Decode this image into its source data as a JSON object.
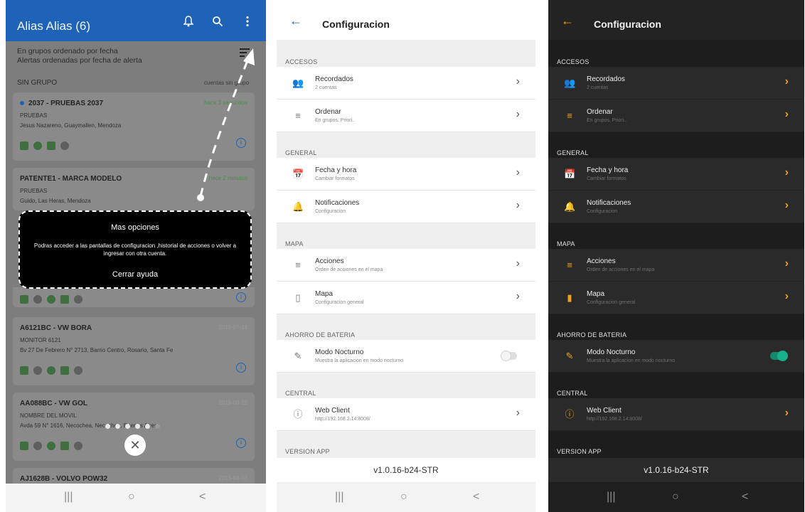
{
  "panel1": {
    "title": "Alias Alias (6)",
    "sub1": "En grupos ordenado por fecha",
    "sub2": "Alertas ordenadas por fecha de alerta",
    "group": "SIN GRUPO",
    "group_right": "cuentas sin grupo",
    "cards": [
      {
        "title": "2037 - PRUEBAS 2037",
        "time": "hace 3 segundos",
        "l2": "PRUEBAS",
        "l3": "Jesus Nazareno, Guaymallen, Mendoza"
      },
      {
        "title": "PATENTE1 - MARCA MODELO",
        "time": "hace 2 minutos",
        "l2": "PRUEBAS",
        "l3": "Guido, Las Heras, Mendoza"
      },
      {
        "title": "A6121BC - VW BORA",
        "time": "2015-07-14",
        "l2": "MONITOR 6121",
        "l3": "Bv 27 De Febrero N° 2713, Barrio Centro, Rosario, Santa Fe"
      },
      {
        "title": "AA088BC - VW GOL",
        "time": "2013-08-22",
        "l2": "NOMBRE DEL MOVIL",
        "l3": "Avda 59 N° 1616, Necochea, Necochea, Buenos Aires"
      },
      {
        "title": "AJ1628B - VOLVO POW32",
        "time": "2013-04-03",
        "l2": "",
        "l3": ""
      }
    ],
    "help": {
      "title": "Mas opciones",
      "body": "Podras acceder a las pantallas de configuracion ,historial de acciones o volver a ingresar con otra cuenta.",
      "close": "Cerrar ayuda"
    }
  },
  "settings": {
    "title": "Configuracion",
    "sections": {
      "accesos": "ACCESOS",
      "general": "GENERAL",
      "mapa": "MAPA",
      "ahorro": "AHORRO DE BATERIA",
      "central": "CENTRAL",
      "version": "VERSION APP"
    },
    "rows": {
      "recordados": {
        "label": "Recordados",
        "desc": "2 cuentas"
      },
      "ordenar": {
        "label": "Ordenar",
        "desc": "En grupos, Priori.."
      },
      "fecha": {
        "label": "Fecha y hora",
        "desc": "Cambiar formatos"
      },
      "notif": {
        "label": "Notificaciones",
        "desc": "Configuracion"
      },
      "acciones": {
        "label": "Acciones",
        "desc": "Orden de acciones en el mapa"
      },
      "mapa": {
        "label": "Mapa",
        "desc": "Configuracion general"
      },
      "nocturno": {
        "label": "Modo Nocturno",
        "desc": "Muestra la aplicacion en modo nocturno"
      },
      "web": {
        "label": "Web Client",
        "desc": "http://192.168.2.14:8008/"
      }
    },
    "version_value": "v1.0.16-b24-STR",
    "night_mode_light": false,
    "night_mode_dark": true
  },
  "navbar": {
    "recents": "|||",
    "home": "○",
    "back": "<"
  },
  "icons": {
    "bell": "bell-icon",
    "search": "search-icon",
    "more": "more-vert-icon"
  }
}
